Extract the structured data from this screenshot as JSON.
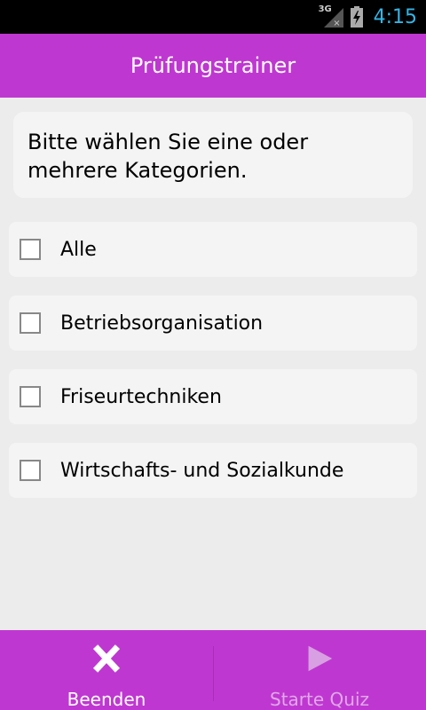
{
  "status_bar": {
    "network": "3G",
    "time": "4:15",
    "icons": [
      "signal-icon",
      "battery-charging-icon"
    ]
  },
  "app_bar": {
    "title": "Prüfungstrainer"
  },
  "instruction": "Bitte wählen Sie eine oder mehrere Kategorien.",
  "categories": [
    {
      "label": "Alle",
      "checked": false
    },
    {
      "label": "Betriebsorganisation",
      "checked": false
    },
    {
      "label": "Friseurtechniken",
      "checked": false
    },
    {
      "label": "Wirtschafts- und Sozialkunde",
      "checked": false
    }
  ],
  "bottom_bar": {
    "quit_label": "Beenden",
    "quit_icon": "close-icon",
    "start_label": "Starte Quiz",
    "start_icon": "play-icon",
    "start_enabled": false
  },
  "colors": {
    "accent": "#bf37d1",
    "clock": "#33b5e5",
    "background": "#ececec",
    "card": "#f4f4f4"
  }
}
